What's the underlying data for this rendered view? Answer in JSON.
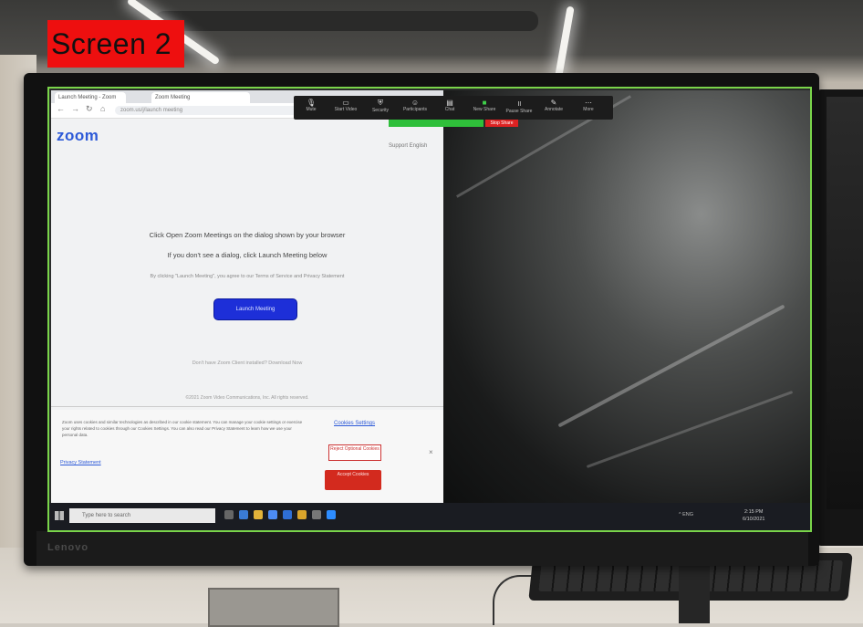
{
  "overlay": {
    "label": "Screen 2"
  },
  "monitor": {
    "brand": "Lenovo"
  },
  "browser": {
    "tab1": "Launch Meeting - Zoom",
    "tab2": "Zoom Meeting",
    "url": "zoom.us/j/launch meeting",
    "logo": "zoom",
    "header_links": "Support   English",
    "message_line1": "Click Open Zoom Meetings on the dialog shown by your browser",
    "message_line2": "If you don't see a dialog, click Launch Meeting below",
    "message_line3": "By clicking \"Launch Meeting\", you agree to our Terms of Service and Privacy Statement",
    "launch_button": "Launch Meeting",
    "help_text": "Don't have Zoom Client installed? Download Now",
    "footer_text": "©2021 Zoom Video Communications, Inc. All rights reserved.",
    "cookie": {
      "text": "Zoom uses cookies and similar technologies as described in our cookie statement. You can manage your cookie settings or exercise your rights related to cookies through our Cookies Settings. You can also read our Privacy Statement to learn how we use your personal data.",
      "privacy_link": "Privacy Statement",
      "settings_link": "Cookies Settings",
      "reject_button": "Reject Optional Cookies",
      "accept_button": "Accept Cookies",
      "close_glyph": "×"
    }
  },
  "zoom_toolbar": {
    "items": [
      "Mute",
      "Start Video",
      "Security",
      "Participants",
      "Chat",
      "New Share",
      "Pause Share",
      "Annotate",
      "More"
    ],
    "stop_share": "Stop Share"
  },
  "taskbar": {
    "search_placeholder": "Type here to search",
    "tray": "^ ENG",
    "time": "2:15 PM",
    "date": "6/10/2021"
  },
  "colors": {
    "overlay_red": "#ee0f0f",
    "zoom_blue": "#1d2fd8",
    "share_green": "#2fbf3a",
    "screen_border": "#7ad54a"
  }
}
